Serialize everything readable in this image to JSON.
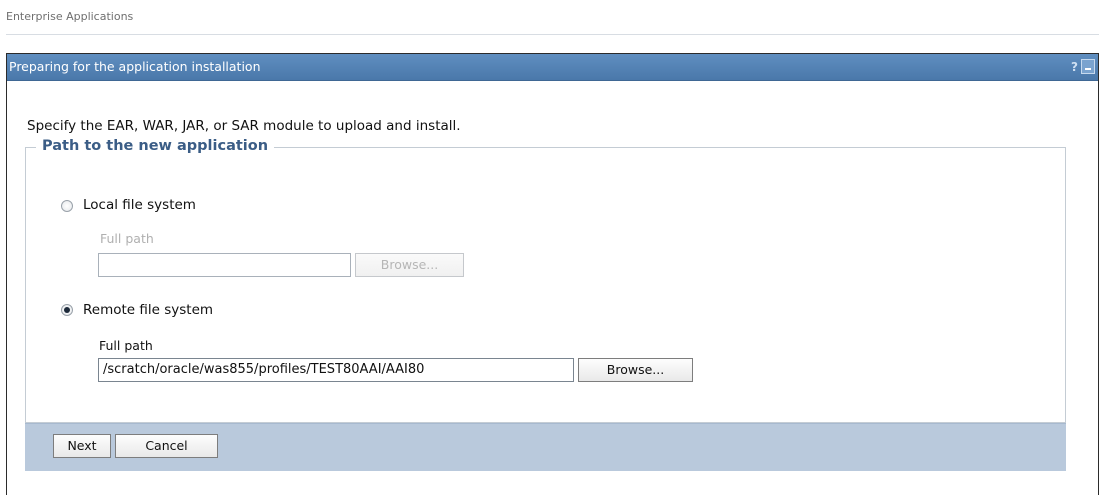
{
  "breadcrumb": {
    "text": "Enterprise Applications"
  },
  "panel": {
    "title": "Preparing for the application installation",
    "help_icon": "?",
    "collapse_icon": "minimize-icon"
  },
  "instructions": "Specify the EAR, WAR, JAR, or SAR module to upload and install.",
  "path_group": {
    "legend": "Path to the new application",
    "local": {
      "label": "Local file system",
      "selected": false,
      "full_path_label": "Full path",
      "value": "",
      "browse_label": "Browse..."
    },
    "remote": {
      "label": "Remote file system",
      "selected": true,
      "full_path_label": "Full path",
      "value": "/scratch/oracle/was855/profiles/TEST80AAI/AAI80",
      "browse_label": "Browse..."
    }
  },
  "buttons": {
    "next": "Next",
    "cancel": "Cancel"
  },
  "colors": {
    "header": "#5f8ec0",
    "footer": "#b9c9dc",
    "legend": "#3b5d86"
  }
}
